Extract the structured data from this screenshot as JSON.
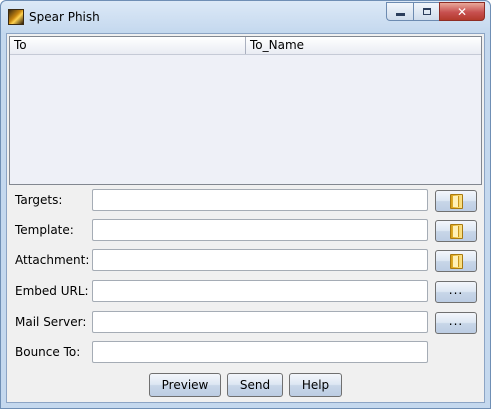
{
  "window": {
    "title": "Spear Phish",
    "icon": "app-icon",
    "controls": {
      "minimize_icon": "minimize-icon",
      "maximize_icon": "maximize-icon",
      "close_glyph": "✕"
    }
  },
  "table": {
    "columns": [
      "To",
      "To_Name"
    ],
    "rows": []
  },
  "form": {
    "targets": {
      "label": "Targets:",
      "value": "",
      "button_icon": "folder-icon"
    },
    "template": {
      "label": "Template:",
      "value": "",
      "button_icon": "folder-icon"
    },
    "attachment": {
      "label": "Attachment:",
      "value": "",
      "button_icon": "folder-icon"
    },
    "embed_url": {
      "label": "Embed URL:",
      "value": "",
      "button_label": "..."
    },
    "mail_server": {
      "label": "Mail Server:",
      "value": "",
      "button_label": "..."
    },
    "bounce_to": {
      "label": "Bounce To:",
      "value": ""
    }
  },
  "actions": {
    "preview": "Preview",
    "send": "Send",
    "help": "Help"
  }
}
